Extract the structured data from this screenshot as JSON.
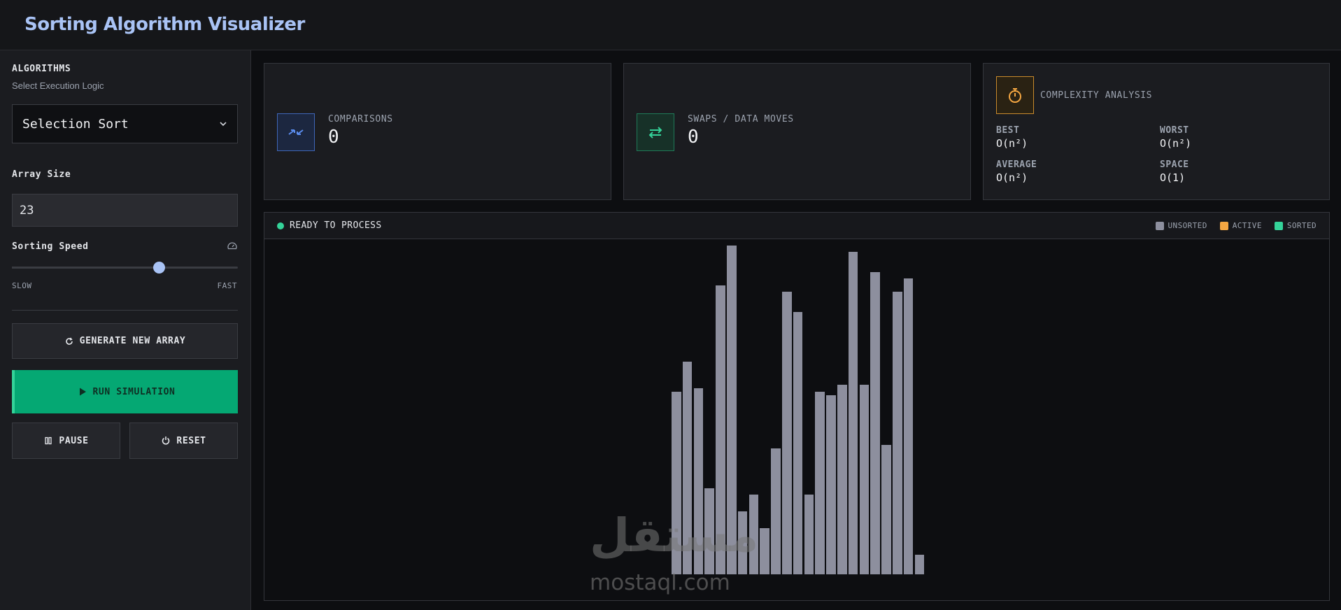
{
  "app": {
    "title": "Sorting Algorithm Visualizer"
  },
  "sidebar": {
    "algorithms_label": "ALGORITHMS",
    "algorithms_sub": "Select Execution Logic",
    "selected_algorithm": "Selection Sort",
    "array_size_label": "Array Size",
    "array_size_value": "23",
    "speed_label": "Sorting Speed",
    "speed_level": 0.65,
    "speed_min_label": "SLOW",
    "speed_max_label": "FAST",
    "generate_label": "GENERATE NEW ARRAY",
    "run_label": "RUN SIMULATION",
    "pause_label": "PAUSE",
    "reset_label": "RESET"
  },
  "stats": {
    "comparisons_label": "COMPARISONS",
    "comparisons_value": "0",
    "swaps_label": "SWAPS / DATA MOVES",
    "swaps_value": "0",
    "complexity_label": "COMPLEXITY ANALYSIS",
    "best_label": "BEST",
    "best_value": "O(n²)",
    "worst_label": "WORST",
    "worst_value": "O(n²)",
    "average_label": "AVERAGE",
    "average_value": "O(n²)",
    "space_label": "SPACE",
    "space_value": "O(1)"
  },
  "visualizer": {
    "status": "READY TO PROCESS",
    "legend": [
      {
        "label": "UNSORTED",
        "color": "#8d8f9e"
      },
      {
        "label": "ACTIVE",
        "color": "#f5a742"
      },
      {
        "label": "SORTED",
        "color": "#34d399"
      }
    ],
    "array": [
      55,
      64,
      56,
      26,
      87,
      99,
      19,
      24,
      14,
      38,
      85,
      79,
      24,
      55,
      54,
      57,
      97,
      57,
      91,
      39,
      85,
      89,
      6
    ]
  },
  "colors": {
    "accent": "#a9c3f5",
    "run": "#05a873",
    "status_ready": "#34d399",
    "comparisons_icon": "#5b8def",
    "swaps_icon": "#34d399",
    "complexity_icon": "#f5a742",
    "bar_unsorted": "#8d8f9e"
  },
  "watermark": {
    "arabic": "مستقل",
    "latin": "mostaql.com"
  }
}
